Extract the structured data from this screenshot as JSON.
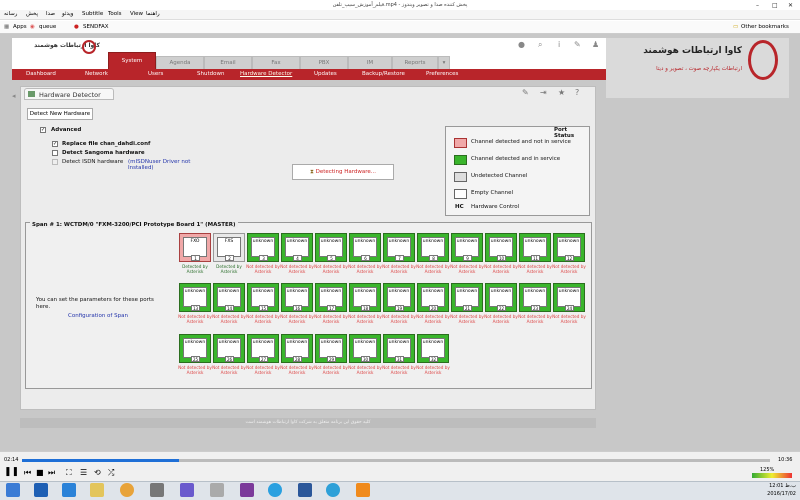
{
  "window": {
    "title": "فیلم_آموزش_سیپ_تلفن.mp4 - پخش کننده صدا و تصویر ویندوز"
  },
  "menu": {
    "items": [
      "راهنما",
      "View",
      "Tools",
      "Subtitle",
      "ویدئو",
      "صدا",
      "پخش",
      "رسانه"
    ]
  },
  "bookmarks": {
    "apps": "Apps",
    "queue": "queue",
    "sendfax": "SENDFAX",
    "other": "Other bookmarks"
  },
  "top_tabs": [
    "System",
    "Agenda",
    "Email",
    "Fax",
    "PBX",
    "IM",
    "Reports"
  ],
  "sub_nav": [
    "Dashboard",
    "Network",
    "Users",
    "Shutdown",
    "Hardware Detector",
    "Updates",
    "Backup/Restore",
    "Preferences"
  ],
  "logo": {
    "left_text": "کاوا ارتباطات هوشمند",
    "right_title": "کاوا ارتباطات هوشمند",
    "right_sub": "ارتباطات یکپارچه صوت ، تصویر و دیتا"
  },
  "panel": {
    "title": "Hardware Detector",
    "detect_btn": "Detect New Hardware",
    "advanced": "Advanced",
    "replace_file": "Replace file chan_dahdi.conf",
    "detect_sangoma": "Detect Sangoma hardware",
    "detect_isdn": "Detect ISDN hardware",
    "isdn_note": "(mISDNuser Driver not Installed)",
    "detecting": "Detecting Hardware..."
  },
  "legend": {
    "title": "Port Status",
    "items": [
      "Channel detected and not in service",
      "Channel detected and in service",
      "Undetected Channel",
      "Empty Channel",
      "Hardware Control"
    ],
    "hc": "HC"
  },
  "span": {
    "title": "Span # 1: WCTDM/0 \"FXM-3200/PCI Prototype Board 1\" (MASTER)",
    "info": "You can set the parameters for these ports here.",
    "config_link": "Configuration of Span"
  },
  "ports": [
    {
      "num": "1",
      "type": "FXO",
      "status": "Detected by Asterisk",
      "kind": "fxo"
    },
    {
      "num": "2",
      "type": "FXS",
      "status": "Detected by Asterisk",
      "kind": "fxs"
    },
    {
      "num": "3",
      "type": "unknown",
      "status": "Not detected by Asterisk",
      "kind": "unk"
    },
    {
      "num": "4",
      "type": "unknown",
      "status": "Not detected by Asterisk",
      "kind": "unk"
    },
    {
      "num": "5",
      "type": "unknown",
      "status": "Not detected by Asterisk",
      "kind": "unk"
    },
    {
      "num": "6",
      "type": "unknown",
      "status": "Not detected by Asterisk",
      "kind": "unk"
    },
    {
      "num": "7",
      "type": "unknown",
      "status": "Not detected by Asterisk",
      "kind": "unk"
    },
    {
      "num": "8",
      "type": "unknown",
      "status": "Not detected by Asterisk",
      "kind": "unk"
    },
    {
      "num": "9",
      "type": "unknown",
      "status": "Not detected by Asterisk",
      "kind": "unk"
    },
    {
      "num": "10",
      "type": "unknown",
      "status": "Not detected by Asterisk",
      "kind": "unk"
    },
    {
      "num": "11",
      "type": "unknown",
      "status": "Not detected by Asterisk",
      "kind": "unk"
    },
    {
      "num": "12",
      "type": "unknown",
      "status": "Not detected by Asterisk",
      "kind": "unk"
    },
    {
      "num": "13",
      "type": "unknown",
      "status": "Not detected by Asterisk",
      "kind": "unk"
    },
    {
      "num": "14",
      "type": "unknown",
      "status": "Not detected by Asterisk",
      "kind": "unk"
    },
    {
      "num": "15",
      "type": "unknown",
      "status": "Not detected by Asterisk",
      "kind": "unk"
    },
    {
      "num": "16",
      "type": "unknown",
      "status": "Not detected by Asterisk",
      "kind": "unk"
    },
    {
      "num": "17",
      "type": "unknown",
      "status": "Not detected by Asterisk",
      "kind": "unk"
    },
    {
      "num": "18",
      "type": "unknown",
      "status": "Not detected by Asterisk",
      "kind": "unk"
    },
    {
      "num": "19",
      "type": "unknown",
      "status": "Not detected by Asterisk",
      "kind": "unk"
    },
    {
      "num": "20",
      "type": "unknown",
      "status": "Not detected by Asterisk",
      "kind": "unk"
    },
    {
      "num": "21",
      "type": "unknown",
      "status": "Not detected by Asterisk",
      "kind": "unk"
    },
    {
      "num": "22",
      "type": "unknown",
      "status": "Not detected by Asterisk",
      "kind": "unk"
    },
    {
      "num": "23",
      "type": "unknown",
      "status": "Not detected by Asterisk",
      "kind": "unk"
    },
    {
      "num": "24",
      "type": "unknown",
      "status": "Not detected by Asterisk",
      "kind": "unk"
    },
    {
      "num": "25",
      "type": "unknown",
      "status": "Not detected by Asterisk",
      "kind": "unk"
    },
    {
      "num": "26",
      "type": "unknown",
      "status": "Not detected by Asterisk",
      "kind": "unk"
    },
    {
      "num": "27",
      "type": "unknown",
      "status": "Not detected by Asterisk",
      "kind": "unk"
    },
    {
      "num": "28",
      "type": "unknown",
      "status": "Not detected by Asterisk",
      "kind": "unk"
    },
    {
      "num": "29",
      "type": "unknown",
      "status": "Not detected by Asterisk",
      "kind": "unk"
    },
    {
      "num": "30",
      "type": "unknown",
      "status": "Not detected by Asterisk",
      "kind": "unk"
    },
    {
      "num": "31",
      "type": "unknown",
      "status": "Not detected by Asterisk",
      "kind": "unk"
    },
    {
      "num": "32",
      "type": "unknown",
      "status": "Not detected by Asterisk",
      "kind": "unk"
    }
  ],
  "footer": "کلیه حقوق این برنامه متعلق به شرکت کاوا ارتباطات هوشمند است",
  "player": {
    "elapsed": "02:14",
    "total": "10:36",
    "progress": 0.21,
    "volume": "125%"
  },
  "taskbar": {
    "time": "12:01 ب.ظ",
    "date": "2016/17/02"
  },
  "colors": {
    "brand_red": "#b8252a",
    "port_green": "#3ab52c",
    "port_red": "#f0a8a8",
    "link_blue": "#2233aa"
  }
}
